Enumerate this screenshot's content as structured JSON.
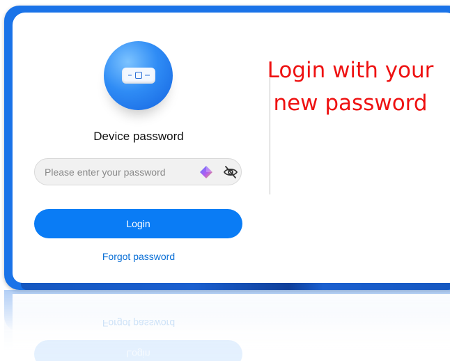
{
  "login_panel": {
    "title": "Device password",
    "password_field": {
      "value": "",
      "placeholder": "Please enter your password"
    },
    "icons": {
      "device": "router-icon",
      "password_manager": "diamond-icon",
      "visibility": "eye-slash-icon"
    },
    "login_label": "Login",
    "forgot_label": "Forgot password"
  },
  "annotation": {
    "line1": "Login with your",
    "line2": "new password",
    "color": "#ee1111"
  },
  "colors": {
    "accent": "#0a7cf5",
    "frame": "#1a73e8",
    "link": "#0a6fd6"
  }
}
